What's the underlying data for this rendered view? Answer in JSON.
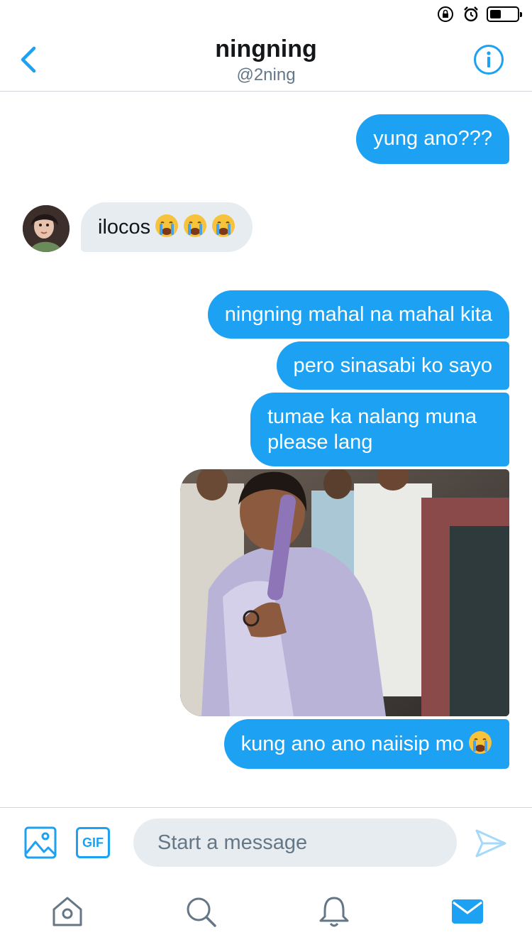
{
  "colors": {
    "accent": "#1da1f2",
    "incoming_bubble": "#e6ecf0",
    "secondary_text": "#657786"
  },
  "status_bar": {
    "icons": [
      "rotation-lock-icon",
      "alarm-icon",
      "battery-icon"
    ],
    "battery_level": 0.4
  },
  "header": {
    "name": "ningning",
    "handle": "@2ning"
  },
  "messages": [
    {
      "direction": "out",
      "text": "yung ano???"
    },
    {
      "direction": "in",
      "text": "ilocos",
      "emoji": [
        "crying-face-icon",
        "crying-face-icon",
        "crying-face-icon"
      ]
    },
    {
      "direction": "out",
      "text": "ningning mahal na mahal kita"
    },
    {
      "direction": "out",
      "text": "pero sinasabi ko sayo"
    },
    {
      "direction": "out",
      "text": "tumae ka nalang muna please lang"
    },
    {
      "direction": "out",
      "type": "image",
      "description_icon": "photo-attachment"
    },
    {
      "direction": "out",
      "text": "kung ano ano naiisip mo",
      "emoji": [
        "crying-face-icon"
      ]
    }
  ],
  "composer": {
    "placeholder": "Start a message",
    "gif_label": "GIF"
  },
  "tabbar": {
    "items": [
      "home-icon",
      "search-icon",
      "notifications-icon",
      "messages-icon"
    ],
    "active": "messages-icon"
  }
}
